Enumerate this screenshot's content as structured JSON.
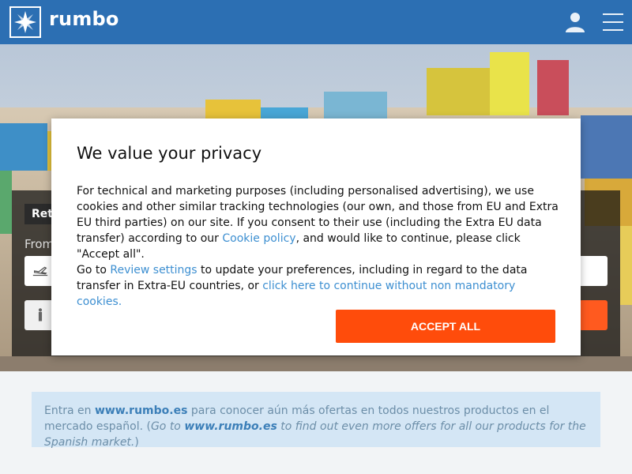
{
  "header": {
    "brand": "rumbo",
    "logo_icon": "rumbo-star-logo-icon",
    "user_icon": "user-icon",
    "menu_icon": "hamburger-menu-icon",
    "bg_color": "#2c6fb3"
  },
  "search": {
    "tab_label": "Ret",
    "from_label": "From"
  },
  "modal": {
    "title": "We value your privacy",
    "p1_a": "For technical and marketing purposes (including personalised advertising), we use cookies and other similar tracking technologies (our own, and those from EU and Extra EU third parties) on our site. If you consent to their use (including the Extra EU data transfer) according to our ",
    "cookie_link": "Cookie policy",
    "p1_b": ", and would like to continue, please click \"Accept all\".",
    "p2_a": "Go to ",
    "review_link": "Review settings",
    "p2_b": " to update your preferences, including in regard to the data transfer in Extra-EU countries, or ",
    "continue_link": "click here to continue without non mandatory cookies.",
    "accept_label": "ACCEPT ALL",
    "accept_color": "#ff4c0b"
  },
  "info": {
    "t1": "Entra en ",
    "site1": "www.rumbo.es",
    "t2": " para conocer aún más ofertas en todos nuestros productos en el mercado español. (",
    "t3": "Go to ",
    "site2": "www.rumbo.es",
    "t4": " to find out even more offers for all our products for the Spanish market.",
    "t5": ")"
  }
}
